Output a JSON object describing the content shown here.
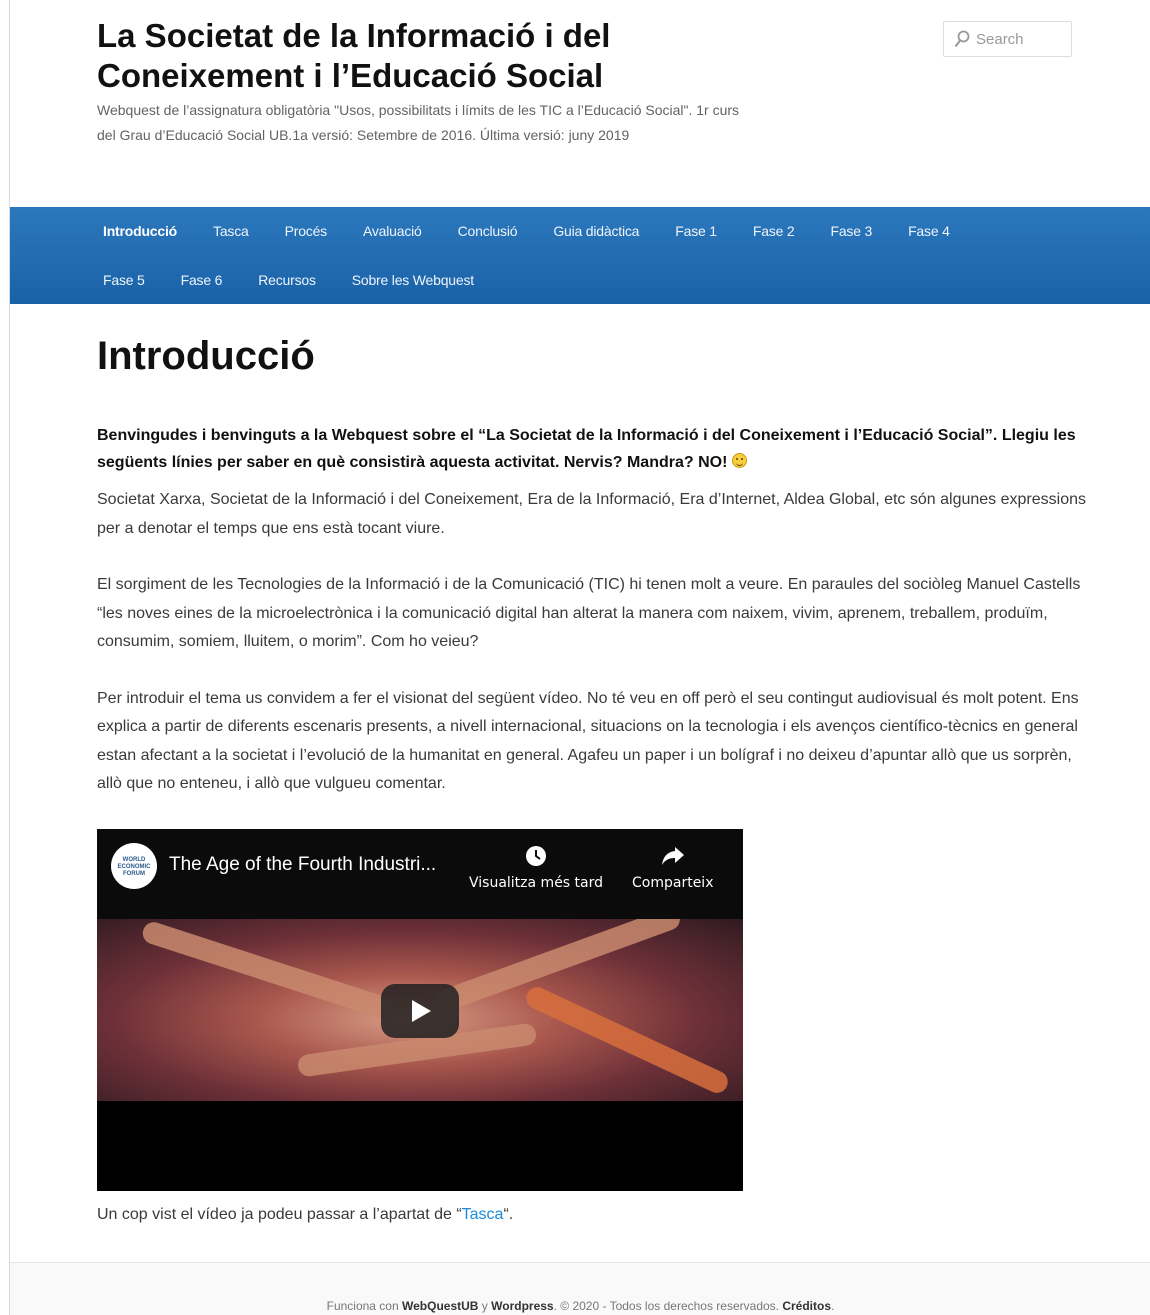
{
  "header": {
    "site_title": "La Societat de la Informació i del Coneixement i l’Educació Social",
    "site_description": "Webquest de l’assignatura obligatòria \"Usos, possibilitats i límits de les TIC a l’Educació Social\". 1r curs del Grau d’Educació Social UB.1a versió: Setembre de 2016. Última versió: juny 2019",
    "search_placeholder": "Search"
  },
  "nav": {
    "row1": [
      "Introducció",
      "Tasca",
      "Procés",
      "Avaluació",
      "Conclusió",
      "Guia didàctica",
      "Fase 1",
      "Fase 2",
      "Fase 3",
      "Fase 4"
    ],
    "row2": [
      "Fase 5",
      "Fase 6",
      "Recursos",
      "Sobre les Webquest"
    ],
    "active": "Introducció"
  },
  "main": {
    "page_title": "Introducció",
    "lead": "Benvingudes i benvinguts a la Webquest sobre el “La Societat de la Informació i del Coneixement i l’Educació Social”. Llegiu les següents línies per saber en què consistirà aquesta activitat. Nervis? Mandra? NO!",
    "paragraphs": [
      "Societat Xarxa, Societat de la Informació i del Coneixement, Era de la Informació, Era d’Internet, Aldea Global, etc són algunes expressions per a denotar el temps que ens està tocant viure.",
      "El sorgiment de les Tecnologies de la Informació i de la Comunicació (TIC) hi tenen molt a veure. En paraules del sociòleg Manuel Castells “les noves eines de la microelectrònica i la comunicació digital han alterat la manera com naixem, vivim, aprenem, treballem, produïm, consumim, somiem, lluitem, o morim”. Com ho veieu?",
      "Per introduir el tema us convidem a fer el visionat del següent vídeo. No té veu en off però el seu contingut audiovisual és molt potent. Ens explica a partir de diferents escenaris presents, a nivell internacional, situacions on la tecnologia i els avenços científico-tècnics en general estan afectant a la societat i l’evolució de la humanitat en general. Agafeu un paper i un bolígraf i no deixeu d’apuntar allò que us sorprèn, allò que no enteneu, i allò que vulgueu comentar."
    ],
    "video": {
      "title": "The Age of the Fourth Industri...",
      "channel_logo_text": "WORLD ECONOMIC FORUM",
      "watch_later": "Visualitza més tard",
      "share": "Comparteix"
    },
    "after_video_prefix": "Un cop vist el vídeo ja podeu passar a l’apartat de “",
    "after_video_link": "Tasca",
    "after_video_suffix": "“."
  },
  "footer": {
    "prefix": "Funciona con ",
    "brand1": "WebQuestUB",
    "mid": " y ",
    "brand2": "Wordpress",
    "rights": ". © 2020 - Todos los derechos reservados. ",
    "credits": "Créditos",
    "end": "."
  }
}
